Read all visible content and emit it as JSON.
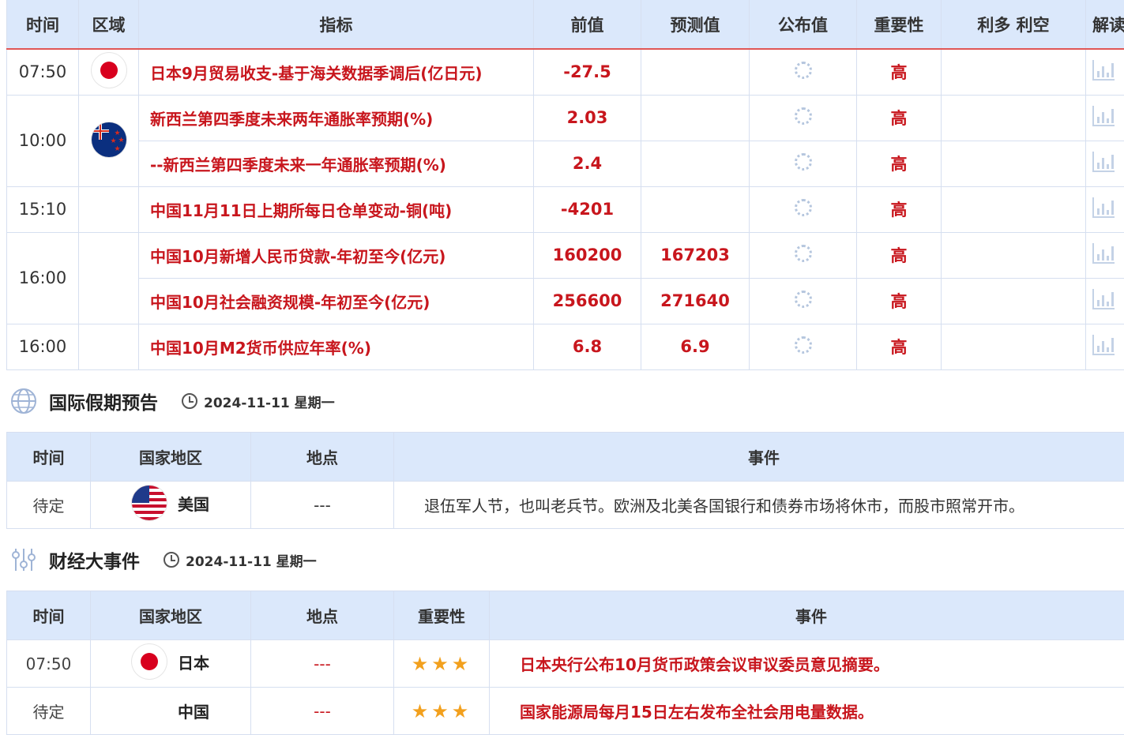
{
  "econ_table": {
    "headers": [
      "时间",
      "区域",
      "指标",
      "前值",
      "预测值",
      "公布值",
      "重要性",
      "利多 利空",
      "解读"
    ],
    "rows": [
      {
        "time": "07:50",
        "indicator": "日本9月贸易收支-基于海关数据季调后(亿日元)",
        "prev": "-27.5",
        "forecast": "",
        "importance": "高"
      },
      {
        "time": "10:00",
        "indicator": "新西兰第四季度未来两年通胀率预期(%)",
        "prev": "2.03",
        "forecast": "",
        "importance": "高"
      },
      {
        "time": "",
        "indicator": "--新西兰第四季度未来一年通胀率预期(%)",
        "prev": "2.4",
        "forecast": "",
        "importance": "高"
      },
      {
        "time": "15:10",
        "indicator": "中国11月11日上期所每日仓单变动-铜(吨)",
        "prev": "-4201",
        "forecast": "",
        "importance": "高"
      },
      {
        "time": "16:00",
        "indicator": "中国10月新增人民币贷款-年初至今(亿元)",
        "prev": "160200",
        "forecast": "167203",
        "importance": "高"
      },
      {
        "time": "",
        "indicator": "中国10月社会融资规模-年初至今(亿元)",
        "prev": "256600",
        "forecast": "271640",
        "importance": "高"
      },
      {
        "time": "16:00",
        "indicator": "中国10月M2货币供应年率(%)",
        "prev": "6.8",
        "forecast": "6.9",
        "importance": "高"
      }
    ]
  },
  "holiday_section": {
    "title": "国际假期预告",
    "date": "2024-11-11 星期一",
    "headers": [
      "时间",
      "国家地区",
      "地点",
      "事件"
    ],
    "rows": [
      {
        "time": "待定",
        "country": "美国",
        "location": "---",
        "event": "退伍军人节，也叫老兵节。欧洲及北美各国银行和债券市场将休市，而股市照常开市。"
      }
    ]
  },
  "events_section": {
    "title": "财经大事件",
    "date": "2024-11-11 星期一",
    "headers": [
      "时间",
      "国家地区",
      "地点",
      "重要性",
      "事件"
    ],
    "rows": [
      {
        "time": "07:50",
        "country": "日本",
        "location": "---",
        "stars": 3,
        "event": "日本央行公布10月货币政策会议审议委员意见摘要。"
      },
      {
        "time": "待定",
        "country": "中国",
        "location": "---",
        "stars": 3,
        "event": "国家能源局每月15日左右发布全社会用电量数据。"
      }
    ]
  },
  "icons": [
    "japan-flag-icon",
    "new-zealand-flag-icon",
    "usa-flag-icon",
    "loading-icon",
    "chart-icon",
    "globe-icon",
    "sliders-icon",
    "clock-icon",
    "star-icon"
  ],
  "colors": {
    "accent_red": "#c8161d",
    "header_bg": "#dbe8fb",
    "star": "#f2a01d"
  }
}
